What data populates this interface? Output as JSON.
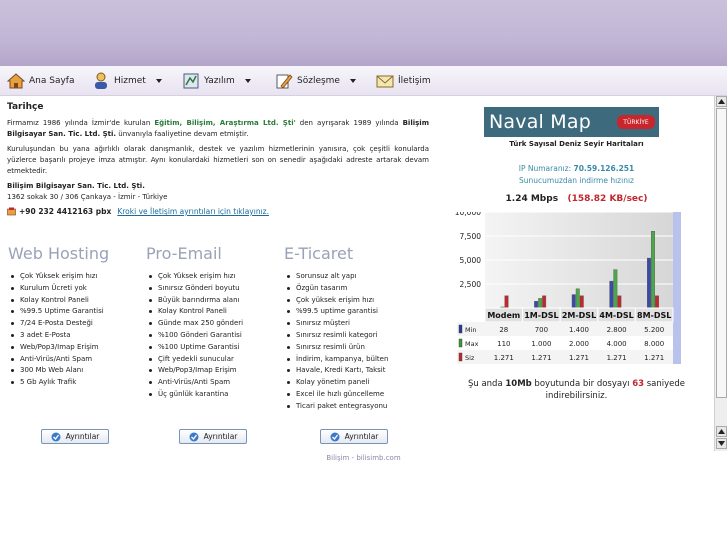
{
  "nav": {
    "items": [
      {
        "label": "Ana Sayfa",
        "icon": "home-icon",
        "dropdown": false
      },
      {
        "label": "Hizmet",
        "icon": "user-icon",
        "dropdown": true
      },
      {
        "label": "Yazılım",
        "icon": "software-icon",
        "dropdown": true
      },
      {
        "label": "Sözleşme",
        "icon": "pencil-icon",
        "dropdown": true
      },
      {
        "label": "İletişim",
        "icon": "mail-icon",
        "dropdown": false
      }
    ]
  },
  "history": {
    "title": "Tarihçe",
    "p1_a": "Firmamız 1986 yılında İzmir'de kurulan ",
    "p1_company": "Eğitim, Bilişim, Araştırma Ltd. Şti'",
    "p1_b": " den ayrışarak 1989 yılında ",
    "p1_company2": "Bilişim Bilgisayar San. Tic. Ltd. Şti.",
    "p1_c": " ünvanıyla faaliyetine devam etmiştir.",
    "p2": "Kuruluşundan bu yana ağırlıklı olarak danışmanlık, destek ve yazılım hizmetlerinin yanısıra, çok çeşitli konularda yüzlerce başarılı projeye imza atmıştır. Aynı konulardaki hizmetleri son on senedir aşağıdaki adreste artarak devam etmektedir.",
    "company_name": "Bilişim Bilgisayar San. Tic. Ltd. Şti.",
    "address": "1362 sokak 30 / 306 Çankaya - İzmir - Türkiye",
    "phone": "+90 232 4412163 pbx",
    "contact_link": "Kroki ve İletişim ayrıntıları için tıklayınız."
  },
  "columns": [
    {
      "title": "Web Hosting",
      "items": [
        "Çok Yüksek erişim hızı",
        "Kurulum Ücreti yok",
        "Kolay Kontrol Paneli",
        "%99.5 Uptime Garantisi",
        "7/24 E-Posta Desteği",
        "3 adet E-Posta",
        "Web/Pop3/Imap Erişim",
        "Anti-Virüs/Anti Spam",
        "300 Mb Web Alanı",
        "5 Gb Aylık Trafik"
      ],
      "button": "Ayrıntılar"
    },
    {
      "title": "Pro-Email",
      "items": [
        "Çok Yüksek erişim hızı",
        "Sınırsız Gönderi boyutu",
        "Büyük barındırma alanı",
        "Kolay Kontrol Paneli",
        "Günde max 250 gönderi",
        "%100 Gönderi Garantisi",
        "%100 Uptime Garantisi",
        "Çift yedekli sunucular",
        "Web/Pop3/Imap Erişim",
        "Anti-Virüs/Anti Spam",
        "Üç günlük karantina"
      ],
      "button": "Ayrıntılar"
    },
    {
      "title": "E-Ticaret",
      "items": [
        "Sorunsuz alt yapı",
        "Özgün tasarım",
        "Çok yüksek erişim hızı",
        "%99.5 uptime garantisi",
        "Sınırsız müşteri",
        "Sınırsız resimli kategori",
        "Sınırsız resimli ürün",
        "İndirim, kampanya, bülten",
        "Havale, Kredi Kartı, Taksit",
        "Kolay yönetim paneli",
        "Excel ile hızlı güncelleme",
        "Ticari paket entegrasyonu"
      ],
      "button": "Ayrıntılar"
    }
  ],
  "naval": {
    "logo_text": "Naval Map",
    "badge": "TÜRKİYE",
    "subtitle": "Türk Sayısal Deniz Seyir Haritaları"
  },
  "speed": {
    "ip_label": "IP Numaranız: ",
    "ip_value": "70.59.126.251",
    "note": "Sunucumuzdan indirme hızınız",
    "mbps": "1.24 Mbps",
    "kbs": "(158.82 KB/sec)"
  },
  "chart_data": {
    "type": "bar",
    "categories": [
      "Modem",
      "1M-DSL",
      "2M-DSL",
      "4M-DSL",
      "8M-DSL"
    ],
    "series": [
      {
        "name": "Min",
        "values": [
          28,
          700,
          1400,
          2800,
          5200
        ],
        "labels": [
          "28",
          "700",
          "1.400",
          "2.800",
          "5.200"
        ],
        "color": "#2a3a9a"
      },
      {
        "name": "Max",
        "values": [
          110,
          1000,
          2000,
          4000,
          8000
        ],
        "labels": [
          "110",
          "1.000",
          "2.000",
          "4.000",
          "8.000"
        ],
        "color": "#3a9a3a"
      },
      {
        "name": "Siz",
        "values": [
          1271,
          1271,
          1271,
          1271,
          1271
        ],
        "labels": [
          "1.271",
          "1.271",
          "1.271",
          "1.271",
          "1.271"
        ],
        "color": "#c0282e"
      }
    ],
    "yticks": [
      2500,
      5000,
      7500,
      10000
    ],
    "ytick_labels": [
      "2,500",
      "5,000",
      "7,500",
      "10,000"
    ],
    "ylim": [
      0,
      10000
    ]
  },
  "download": {
    "pre": "Şu anda ",
    "size": "10Mb",
    "mid": " boyutunda bir dosyayı ",
    "secs": "63",
    "post": " saniyede indirebilirsiniz."
  },
  "footer": {
    "text": "Bilişim - bilisimb.com"
  }
}
